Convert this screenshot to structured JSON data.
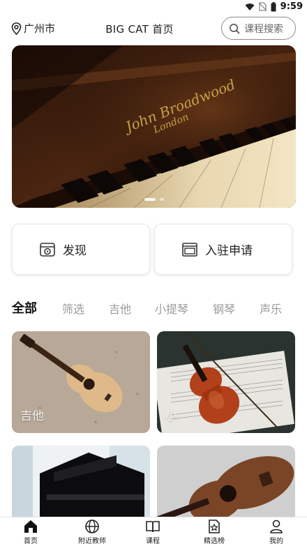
{
  "status_bar": {
    "time": "9:59"
  },
  "header": {
    "location": "广州市",
    "title": "BIG CAT 首页",
    "search_placeholder": "课程搜索"
  },
  "banner": {
    "image": "piano-keys-photo",
    "page_count": 3,
    "active_page": 1
  },
  "quick_actions": [
    {
      "label": "发现",
      "icon": "discover-icon"
    },
    {
      "label": "入驻申请",
      "icon": "apply-icon"
    }
  ],
  "categories": [
    "全部",
    "筛选",
    "吉他",
    "小提琴",
    "钢琴",
    "声乐"
  ],
  "active_category": "全部",
  "courses": [
    {
      "label": "吉他",
      "image": "acoustic-guitar-photo"
    },
    {
      "label": "小",
      "image": "violin-photo"
    },
    {
      "label": "",
      "image": "grand-piano-photo"
    },
    {
      "label": "",
      "image": "ukulele-photo"
    }
  ],
  "bottom_nav": [
    {
      "label": "首页",
      "icon": "home-icon",
      "active": true
    },
    {
      "label": "附近教师",
      "icon": "globe-icon",
      "active": false
    },
    {
      "label": "课程",
      "icon": "book-icon",
      "active": false
    },
    {
      "label": "精选榜",
      "icon": "ranking-icon",
      "active": false
    },
    {
      "label": "我的",
      "icon": "profile-icon",
      "active": false
    }
  ]
}
